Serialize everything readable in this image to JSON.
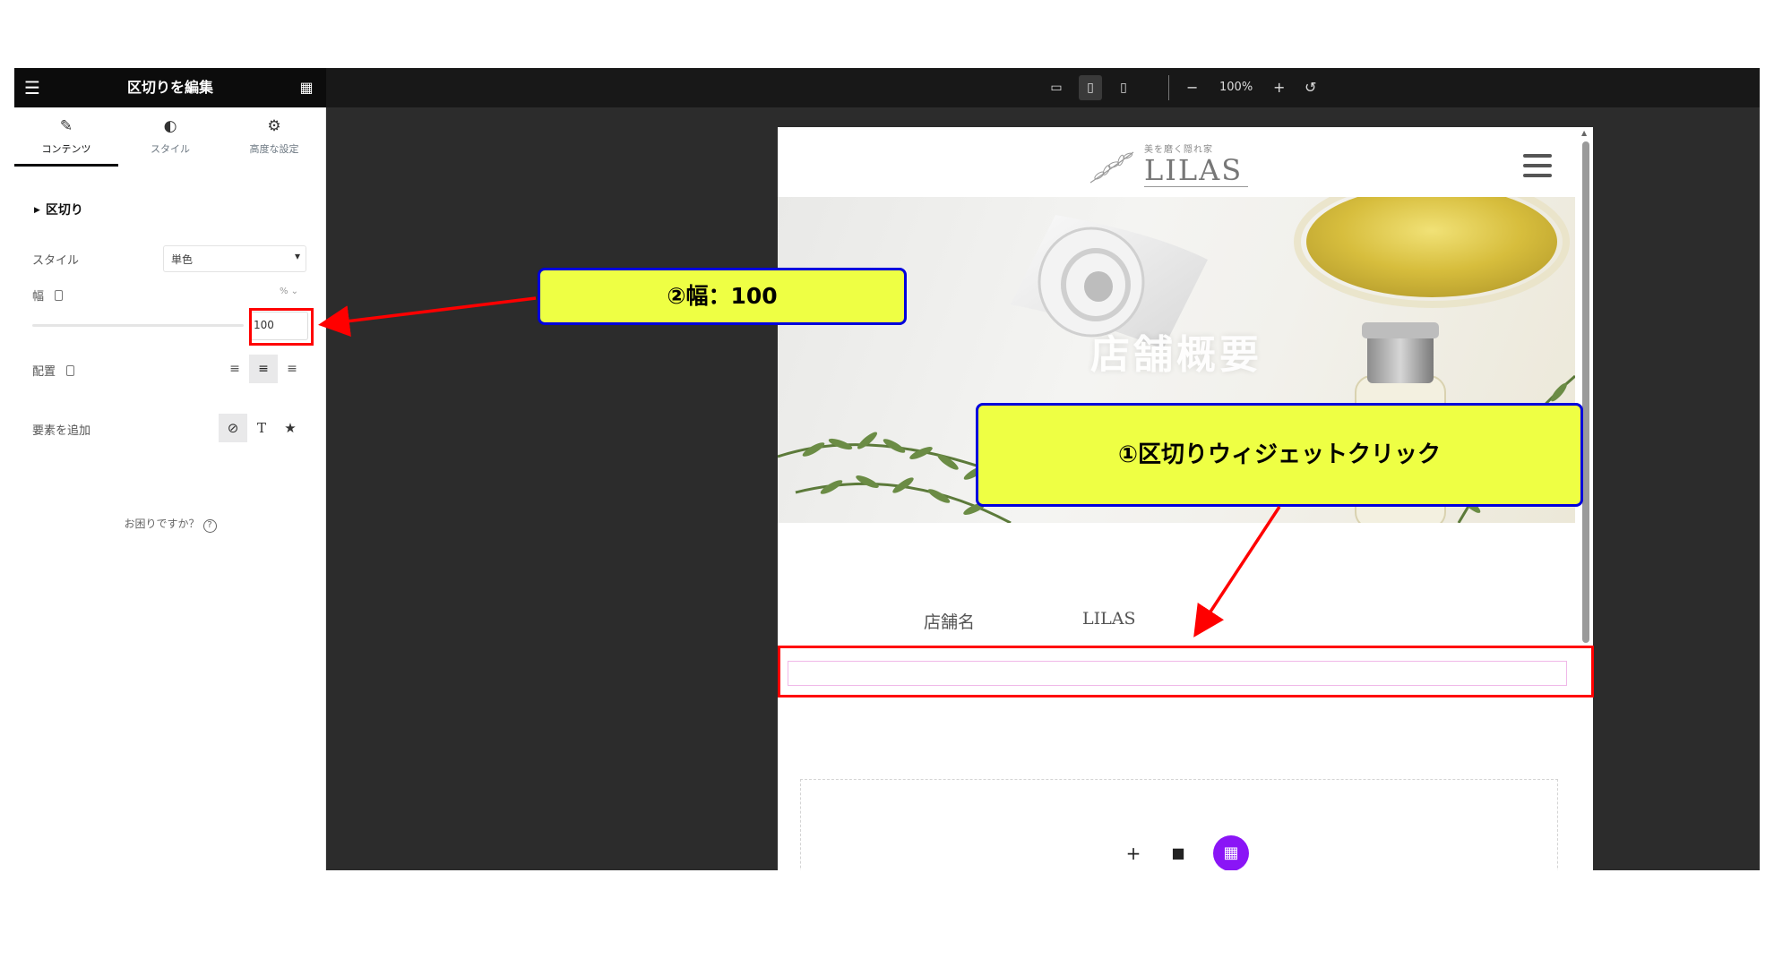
{
  "editor": {
    "title": "区切りを編集",
    "tabs": [
      {
        "icon": "pencil-icon",
        "label": "コンテンツ"
      },
      {
        "icon": "contrast-icon",
        "label": "スタイル"
      },
      {
        "icon": "gear-icon",
        "label": "高度な設定"
      }
    ],
    "section_title": "区切り",
    "style_label": "スタイル",
    "style_value": "単色",
    "width_label": "幅",
    "width_unit": "% ⌄",
    "width_value": "100",
    "align_label": "配置",
    "add_element_label": "要素を追加",
    "help_text": "お困りですか？",
    "help_icon": "?"
  },
  "topbar": {
    "zoom": "100%"
  },
  "preview": {
    "logo_tagline": "美を磨く隠れ家",
    "logo_name": "LILAS",
    "hero_title": "店舗概要",
    "info_label": "店舗名",
    "info_value": "LILAS"
  },
  "annotations": {
    "callout_width": "②幅：100",
    "callout_click": "①区切りウィジェットクリック"
  },
  "colors": {
    "annotation_red": "#ff0000",
    "callout_fill": "#eeff44",
    "callout_border": "#0000dd",
    "editor_dark": "#0c0c0c",
    "canvas_bg": "#2c2c2c",
    "elementor_purple": "#8a15f6"
  }
}
